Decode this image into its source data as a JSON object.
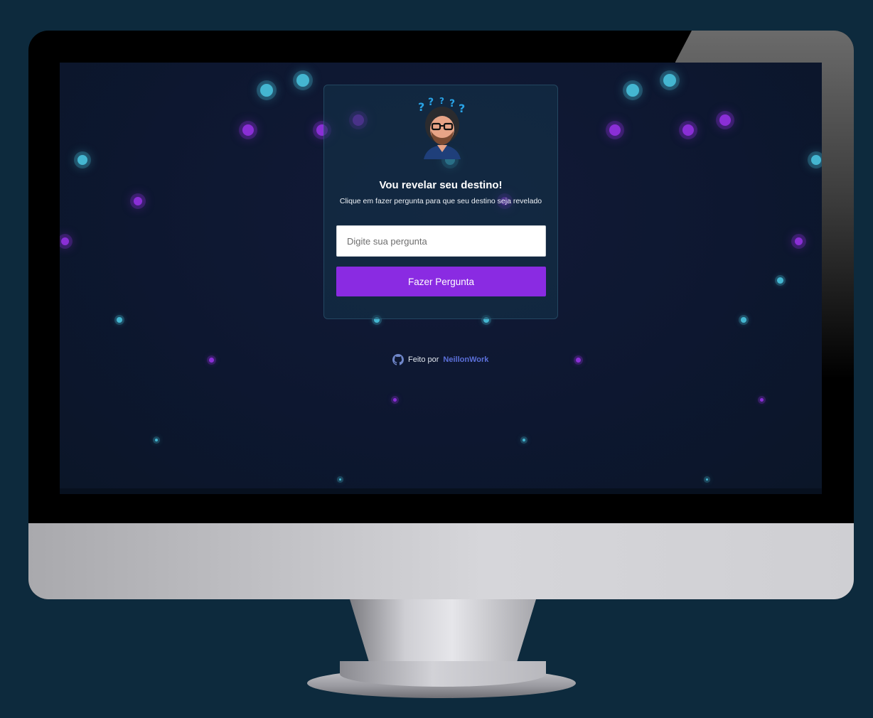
{
  "card": {
    "title": "Vou revelar seu destino!",
    "subtitle": "Clique em fazer pergunta para que seu destino seja revelado",
    "input_placeholder": "Digite sua pergunta",
    "input_value": "",
    "button_label": "Fazer Pergunta"
  },
  "footer": {
    "made_by": "Feito por",
    "author": "NeillonWork",
    "icon": "github-icon"
  },
  "colors": {
    "background": "#0d2a3d",
    "screen": "#0d1730",
    "accent": "#8a2be2",
    "dot_cyan": "#44b6d1",
    "dot_purple": "#8a2fd6",
    "link": "#5b6fd9"
  }
}
